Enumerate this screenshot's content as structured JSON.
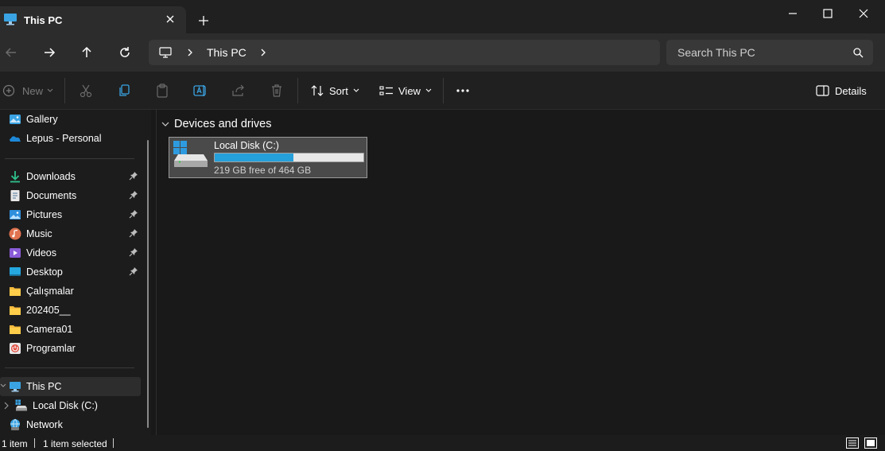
{
  "window": {
    "tab_title": "This PC",
    "minimize_icon": "minimize-icon",
    "maximize_icon": "maximize-icon",
    "close_icon": "close-icon"
  },
  "address": {
    "breadcrumb": [
      "This PC"
    ],
    "search_placeholder": "Search This PC"
  },
  "toolbar": {
    "new_label": "New",
    "sort_label": "Sort",
    "view_label": "View",
    "details_label": "Details"
  },
  "sidebar": {
    "items": [
      {
        "label": "Gallery",
        "icon": "gallery-icon",
        "pinned": false
      },
      {
        "label": "Lepus - Personal",
        "icon": "onedrive-icon",
        "pinned": false
      },
      {
        "label": "Downloads",
        "icon": "downloads-icon",
        "pinned": true
      },
      {
        "label": "Documents",
        "icon": "documents-icon",
        "pinned": true
      },
      {
        "label": "Pictures",
        "icon": "pictures-icon",
        "pinned": true
      },
      {
        "label": "Music",
        "icon": "music-icon",
        "pinned": true
      },
      {
        "label": "Videos",
        "icon": "videos-icon",
        "pinned": true
      },
      {
        "label": "Desktop",
        "icon": "desktop-icon",
        "pinned": true
      },
      {
        "label": "Çalışmalar",
        "icon": "folder-icon",
        "pinned": false
      },
      {
        "label": "202405__",
        "icon": "folder-icon",
        "pinned": false
      },
      {
        "label": "Camera01",
        "icon": "folder-icon",
        "pinned": false
      },
      {
        "label": "Programlar",
        "icon": "programs-icon",
        "pinned": false
      },
      {
        "label": "This PC",
        "icon": "this-pc-icon",
        "selected": true
      },
      {
        "label": "Local Disk (C:)",
        "icon": "drive-icon"
      },
      {
        "label": "Network",
        "icon": "network-icon"
      }
    ]
  },
  "content": {
    "group_title": "Devices and drives",
    "drives": [
      {
        "name": "Local Disk (C:)",
        "free_text": "219 GB free of 464 GB",
        "used_fraction": 0.528
      }
    ]
  },
  "status": {
    "count": "1 item",
    "selected": "1 item selected"
  },
  "colors": {
    "accent": "#26a0da",
    "background": "#191919",
    "toolbar": "#202020",
    "address_bg": "#2c2c2c"
  }
}
